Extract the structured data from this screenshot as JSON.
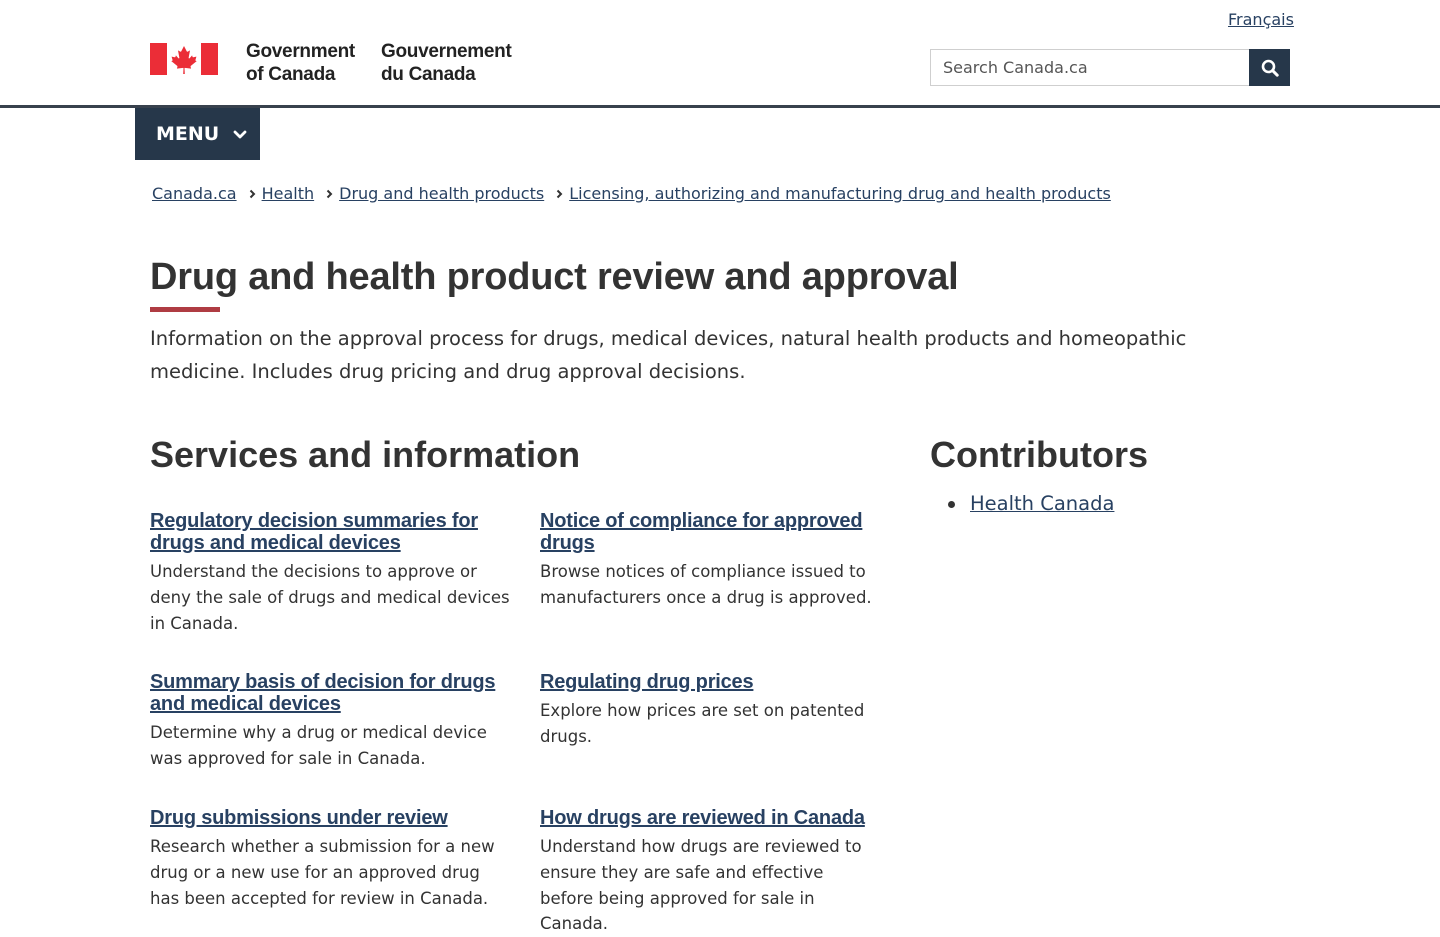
{
  "header": {
    "language_link": "Français",
    "fip_en_line1": "Government",
    "fip_en_line2": "of Canada",
    "fip_fr_line1": "Gouvernement",
    "fip_fr_line2": "du Canada",
    "search_placeholder": "Search Canada.ca",
    "search_icon": "search-icon",
    "flag_icon": "canada-flag-icon"
  },
  "menu": {
    "label": "MENU",
    "icon": "chevron-down-icon"
  },
  "breadcrumbs": [
    "Canada.ca",
    "Health",
    "Drug and health products",
    "Licensing, authorizing and manufacturing drug and health products"
  ],
  "page": {
    "title": "Drug and health product review and approval",
    "intro": "Information on the approval process for drugs, medical devices, natural health products and homeopathic medicine. Includes drug pricing and drug approval decisions."
  },
  "services": {
    "heading": "Services and information",
    "items": [
      {
        "title": "Regulatory decision summaries for drugs and medical devices",
        "desc": "Understand the decisions to approve or deny the sale of drugs and medical devices in Canada."
      },
      {
        "title": "Notice of compliance for approved drugs",
        "desc": "Browse notices of compliance issued to manufacturers once a drug is approved."
      },
      {
        "title": "Summary basis of decision for drugs and medical devices",
        "desc": "Determine why a drug or medical device was approved for sale in Canada."
      },
      {
        "title": "Regulating drug prices",
        "desc": "Explore how prices are set on patented drugs."
      },
      {
        "title": "Drug submissions under review",
        "desc": "Research whether a submission for a new drug or a new use for an approved drug has been accepted for review in Canada."
      },
      {
        "title": "How drugs are reviewed in Canada",
        "desc": "Understand how drugs are reviewed to ensure they are safe and effective before being approved for sale in Canada."
      }
    ]
  },
  "contributors": {
    "heading": "Contributors",
    "items": [
      "Health Canada"
    ]
  },
  "colors": {
    "link": "#284162",
    "menu_bg": "#26374a",
    "title_accent": "#af3c43",
    "flag_red": "#eb2d37"
  }
}
